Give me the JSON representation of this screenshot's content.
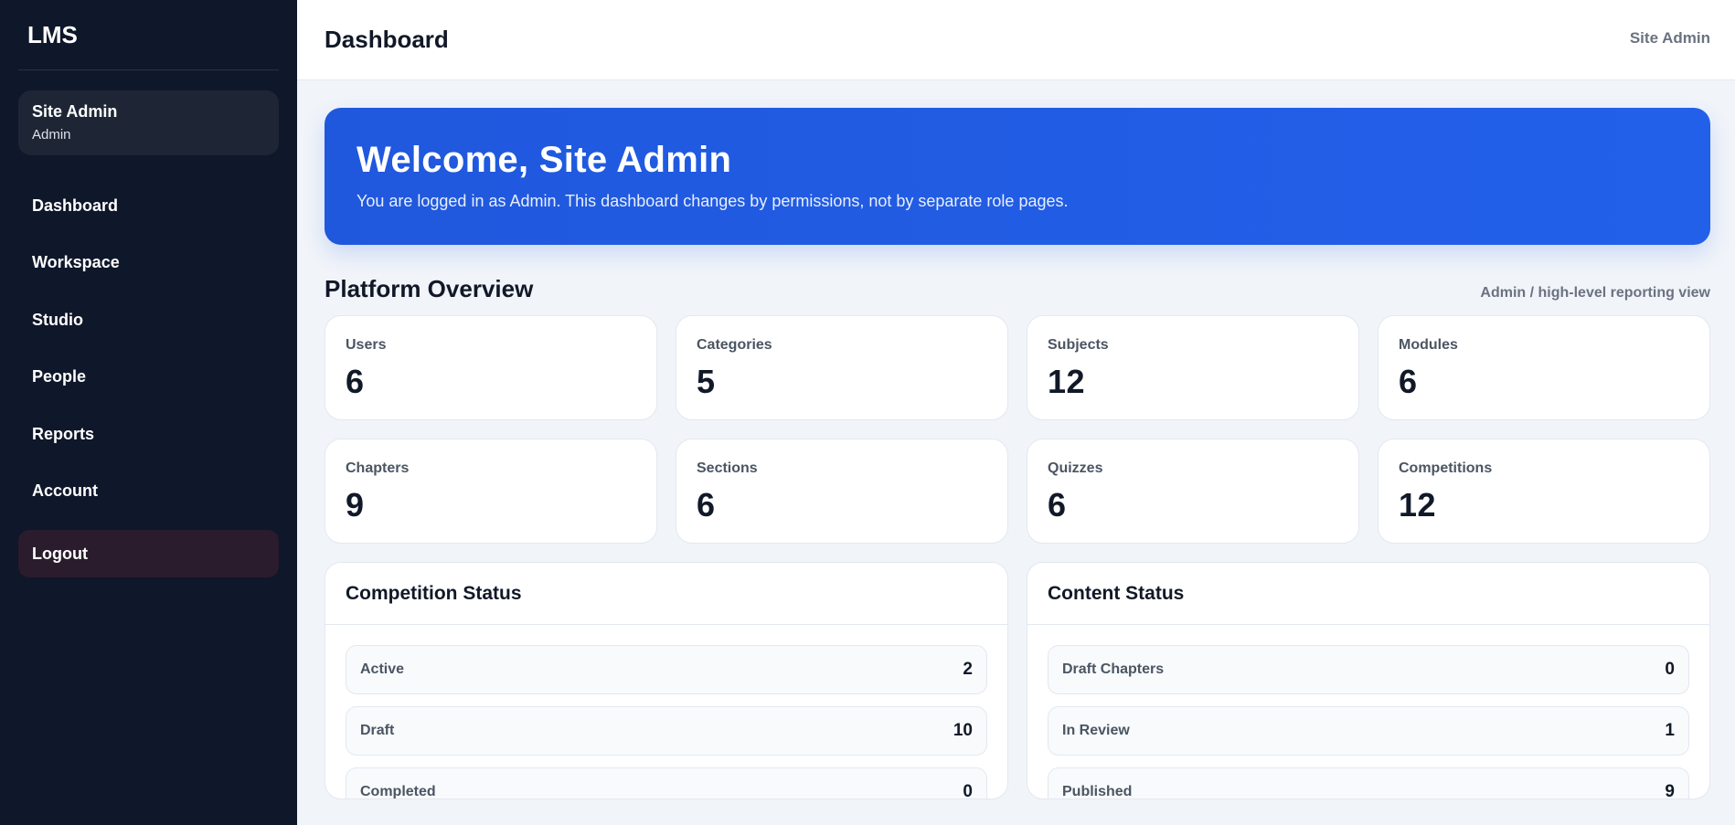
{
  "sidebar": {
    "brand": "LMS",
    "user": {
      "name": "Site Admin",
      "role": "Admin"
    },
    "nav": [
      {
        "label": "Dashboard"
      },
      {
        "label": "Workspace"
      },
      {
        "label": "Studio"
      },
      {
        "label": "People"
      },
      {
        "label": "Reports"
      },
      {
        "label": "Account"
      }
    ],
    "logout_label": "Logout"
  },
  "header": {
    "title": "Dashboard",
    "user": "Site Admin"
  },
  "hero": {
    "title": "Welcome, Site Admin",
    "subtitle": "You are logged in as Admin. This dashboard changes by permissions, not by separate role pages."
  },
  "overview": {
    "title": "Platform Overview",
    "note": "Admin / high-level reporting view",
    "stats": [
      {
        "label": "Users",
        "value": "6"
      },
      {
        "label": "Categories",
        "value": "5"
      },
      {
        "label": "Subjects",
        "value": "12"
      },
      {
        "label": "Modules",
        "value": "6"
      },
      {
        "label": "Chapters",
        "value": "9"
      },
      {
        "label": "Sections",
        "value": "6"
      },
      {
        "label": "Quizzes",
        "value": "6"
      },
      {
        "label": "Competitions",
        "value": "12"
      }
    ]
  },
  "competition_status": {
    "title": "Competition Status",
    "rows": [
      {
        "label": "Active",
        "value": "2"
      },
      {
        "label": "Draft",
        "value": "10"
      },
      {
        "label": "Completed",
        "value": "0"
      }
    ]
  },
  "content_status": {
    "title": "Content Status",
    "rows": [
      {
        "label": "Draft Chapters",
        "value": "0"
      },
      {
        "label": "In Review",
        "value": "1"
      },
      {
        "label": "Published",
        "value": "9"
      }
    ]
  },
  "colors": {
    "sidebar_bg": "#0f172a",
    "accent_blue": "#2563eb",
    "logout_bg": "#2a1c2c"
  }
}
